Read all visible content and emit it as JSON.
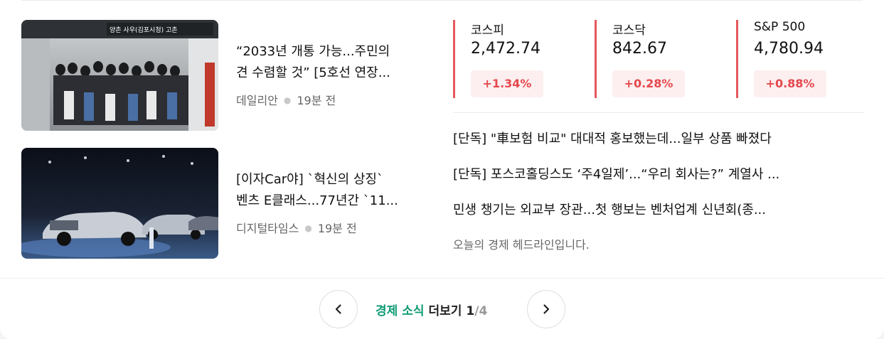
{
  "news_items": [
    {
      "title_line1": "“2033년 개통 가능...주민의",
      "title_line2": "견 수렴할 것” [5호선 연장...",
      "source": "데일리안",
      "time": "19분 전",
      "sign_text": "양촌 사우(김포시청) 고촌"
    },
    {
      "title_line1": "[이자Car야] `혁신의 상징`",
      "title_line2": "벤츠 E클래스...77년간 `11...",
      "source": "디지털타임스",
      "time": "19분 전"
    }
  ],
  "stocks": [
    {
      "name": "코스피",
      "value": "2,472.74",
      "change": "+1.34%"
    },
    {
      "name": "코스닥",
      "value": "842.67",
      "change": "+0.28%"
    },
    {
      "name": "S&P 500",
      "value": "4,780.94",
      "change": "+0.88%"
    }
  ],
  "headlines": [
    "[단독] \"車보험 비교\" 대대적 홍보했는데...일부 상품 빠졌다",
    "[단독] 포스코홀딩스도 ‘주4일제’...“우리 회사는?” 계열사 ...",
    "민생 챙기는 외교부 장관...첫 행보는 벤처업계 신년회(종..."
  ],
  "headline_summary": "오늘의 경제 헤드라인입니다.",
  "pager": {
    "accent": "경제 소식",
    "label": "더보기",
    "current": "1",
    "total": "/4"
  },
  "colors": {
    "rise": "#e5484d",
    "rise_bg": "#fdeff0",
    "accent": "#0e9c74"
  }
}
